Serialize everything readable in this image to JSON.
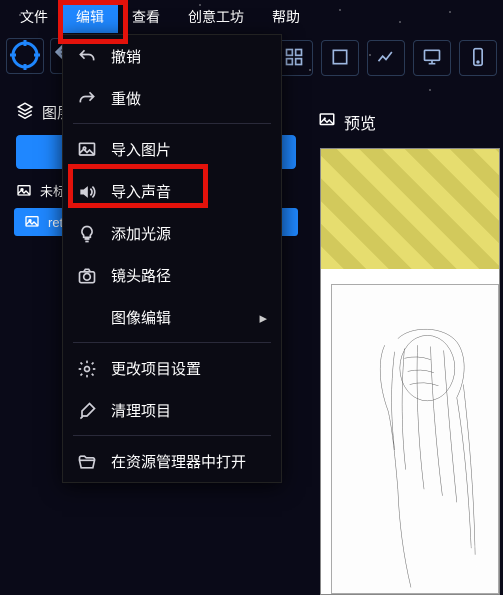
{
  "menubar": {
    "file": "文件",
    "edit": "编辑",
    "view": "查看",
    "workshop": "创意工坊",
    "help": "帮助"
  },
  "dropdown": {
    "undo": "撤销",
    "redo": "重做",
    "import_image": "导入图片",
    "import_sound": "导入声音",
    "add_light": "添加光源",
    "camera_path": "镜头路径",
    "image_edit": "图像编辑",
    "project_settings": "更改项目设置",
    "cleanup": "清理项目",
    "open_explorer": "在资源管理器中打开"
  },
  "side": {
    "layers_label": "图层",
    "untitled_prefix": "未标",
    "retouch_label": "reto"
  },
  "preview": {
    "label": "预览"
  },
  "colors": {
    "accent": "#1f87ff",
    "highlight": "#e3120b"
  }
}
